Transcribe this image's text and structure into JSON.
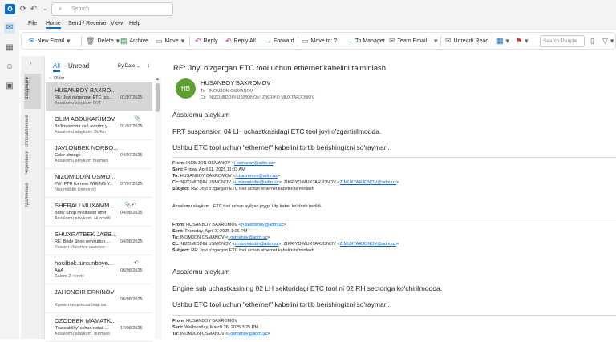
{
  "search": {
    "placeholder": "Search"
  },
  "menu": [
    "File",
    "Home",
    "Send / Receive",
    "View",
    "Help"
  ],
  "ribbon": {
    "new_email": "New Email",
    "delete": "Delete",
    "archive": "Archive",
    "move": "Move",
    "reply": "Reply",
    "reply_all": "Reply All",
    "forward": "Forward",
    "move_to": "Move to: ?",
    "to_manager": "To Manager",
    "team_email": "Team Email",
    "unread_read": "Unread/ Read",
    "search_people": "Search People"
  },
  "folders": [
    "Входящие",
    "Отправленные",
    "Черновики",
    "Удаленные"
  ],
  "list": {
    "tab_all": "All",
    "tab_unread": "Unread",
    "sort": "By Date",
    "group": "Older",
    "messages": [
      {
        "from": "HUSANBOY BAXRO...",
        "subject": "RE: Joyi o'zgargan ETC too...",
        "preview": "Assalomu aleykum  FRT",
        "date": "01/07/2025",
        "selected": true
      },
      {
        "from": "OLIM ABDUKARIMOV",
        "subject": "Bo'lim nizomi va Lavozim y...",
        "preview": "Assalomu alaykum!   Bo'lim",
        "date": "01/07/2025",
        "icon": "paperclip-icon"
      },
      {
        "from": "JAVLONBEK NORBO...",
        "subject": "Color change",
        "preview": "Assalomu aleykum hurmatli",
        "date": "04/07/2025"
      },
      {
        "from": "NIZOMIDDIN USMO...",
        "subject": "FW: PTR for new WIRING Y...",
        "preview": "Nizomiddin Usmonov",
        "date": "07/07/2025"
      },
      {
        "from": "SHERALI MUXAMM...",
        "subject": "Body Shop revolution offer",
        "preview": "Assalomu alaykum. Hurmatli",
        "date": "04/08/2025",
        "icon": "paperclip-reply-icon"
      },
      {
        "from": "SHUXRATBEK JABB...",
        "subject": "RE: Body Shop revolution ...",
        "preview": "Рахмат Иноятов салохат",
        "date": "04/08/2025"
      },
      {
        "from": "hosilbek.tursunboye...",
        "subject": "AAA",
        "preview": "Salom 2 <end>",
        "date": "06/08/2025",
        "icon": "reply-icon"
      },
      {
        "from": "JAHONGIR ERKINOV",
        "subject": "",
        "preview": "Хурматли цемсазблар ва",
        "date": "06/08/2025"
      },
      {
        "from": "OZODBEK MAMATK...",
        "subject": "'Traceability' uchun detail ...",
        "preview": "Assalomu alaykum, hurmatli",
        "date": "17/08/2025"
      }
    ]
  },
  "reading": {
    "subject": "RE: Joyi o'zgargan ETC tool uchun ethernet kabelini ta'minlash",
    "avatar": "HB",
    "sender": "HUSANBOY BAXROMOV",
    "to_label": "To",
    "to": "INOMJON OSMANOV",
    "cc_label": "Cc",
    "cc": "NIZOMIDDIN USMONOV; ZIKRIYO MUXTARJONOV",
    "greeting": "Assalomu aleykum",
    "line1": "FRT suspension 04 LH uchastkasidagi ETC tool joyi o'zgartirilmoqda.",
    "line2": "Ushbu ETC tool uchun  \"ethernet\" kabelini tortib berishingizni so'rayman.",
    "q1": {
      "from_label": "From:",
      "from": "INOMJON OSMANOV <",
      "from_email": "i.osmanov@adm.uz",
      "from_end": ">",
      "sent_label": "Sent:",
      "sent": "Friday, April 11, 2025 11:03 AM",
      "to_label": "To:",
      "to": "HUSANBOY BAXROMOV <",
      "to_email": "h.baxromov@adm.uz",
      "to_end": ">",
      "cc_label": "Cc:",
      "cc1": "NIZOMIDDIN USMONOV <",
      "cc1_email": "u.nizomiddin@adm.uz",
      "cc2": ">; ZIKRIYO MUXTARJONOV <",
      "cc2_email": "Z.MUXTARJONOV@adm.uz",
      "cc_end": ">",
      "subject_label": "Subject:",
      "subject": "RE: Joyi o'zgargan ETC tool uchun ethernet kabelini ta'minlash",
      "body": "Assalomu alaykum . ETC tool uchun ayilgan joyga Utp kabel ko'chirib berildi."
    },
    "q2": {
      "from_label": "From:",
      "from": "HUSANBOY BAXROMOV <",
      "from_email": "h.baxromov@adm.uz",
      "from_end": ">",
      "sent_label": "Sent:",
      "sent": "Thursday, April 3, 2025 1:06 PM",
      "to_label": "To:",
      "to": "INOMJON OSMANOV <",
      "to_email": "i.osmanov@adm.uz",
      "to_end": ">",
      "cc_label": "Cc:",
      "cc1": "NIZOMIDDIN USMONOV <",
      "cc1_email": "u.nizomiddin@adm.uz",
      "cc2": ">; ZIKRIYO MUXTARJONOV <",
      "cc2_email": "Z.MUXTARJONOV@adm.uz",
      "cc_end": ">",
      "subject_label": "Subject:",
      "subject": "RE: Joyi o'zgargan ETC tool uchun ethernet kabelini ta'minlash",
      "greeting": "Assalomu aleykum",
      "line1": "Engine sub uchastkasining 02 LH sektoridagi ETC tool ni 02 RH sectoriga ko'chirilmoqda.",
      "line2": "Ushbu ETC tool uchun  \"ethernet\" kabelini tortib berishingizni so'rayman."
    },
    "q3": {
      "from_label": "From:",
      "from": "HUSANBOY BAXROMOV",
      "sent_label": "Sent:",
      "sent": "Wednesday, March 26, 2025 3:25 PM",
      "to_label": "To:",
      "to": "INOMJON OSMANOV <",
      "to_email": "i.osmanov@adm.uz",
      "to_end": ">"
    }
  }
}
